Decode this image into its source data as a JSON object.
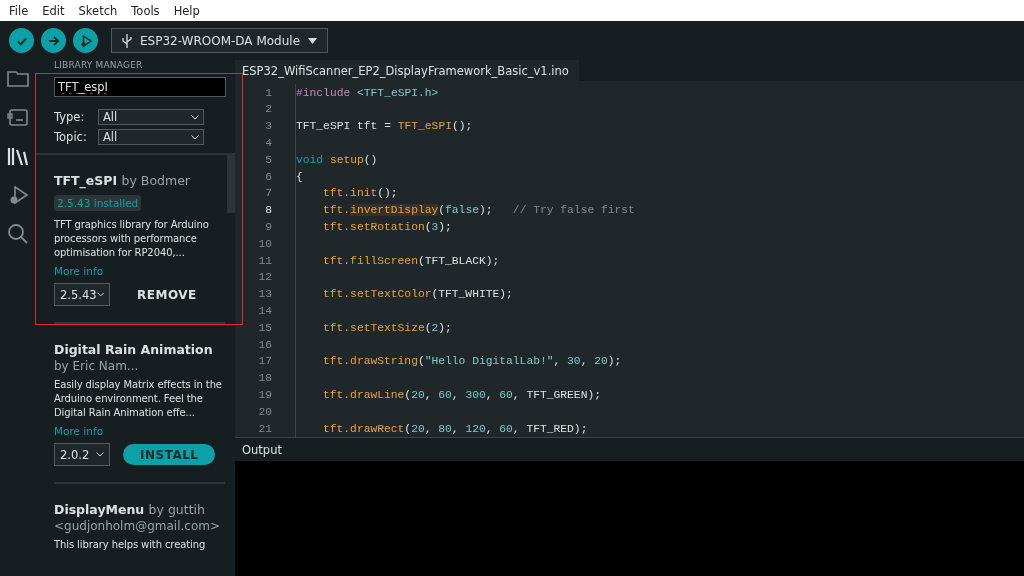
{
  "menu": [
    "File",
    "Edit",
    "Sketch",
    "Tools",
    "Help"
  ],
  "toolbar": {
    "buttons": [
      {
        "kind": "verify"
      },
      {
        "kind": "upload"
      },
      {
        "kind": "debug"
      }
    ],
    "board": "ESP32-WROOM-DA Module"
  },
  "activity_bar": [
    {
      "kind": "folder",
      "selected": false
    },
    {
      "kind": "board",
      "selected": false
    },
    {
      "kind": "library",
      "selected": true
    },
    {
      "kind": "debug",
      "selected": false
    },
    {
      "kind": "search",
      "selected": false
    }
  ],
  "library_manager": {
    "title": "LIBRARY MANAGER",
    "search_value": "TFT_espI",
    "filters": [
      {
        "label": "Type:",
        "value": "All"
      },
      {
        "label": "Topic:",
        "value": "All"
      }
    ],
    "libraries": [
      {
        "name": "TFT_eSPI",
        "author": "by Bodmer",
        "installed_badge": "2.5.43 installed",
        "description": "TFT graphics library for Arduino processors with performance optimisation for RP2040,...",
        "more_info": "More info",
        "version": "2.5.43",
        "action": {
          "kind": "remove",
          "label": "REMOVE"
        }
      },
      {
        "name": "Digital Rain Animation",
        "author": "by Eric Nam...",
        "description": "Easily display Matrix effects in the Arduino environment. Feel the Digital Rain Animation effe...",
        "more_info": "More info",
        "version": "2.0.2",
        "action": {
          "kind": "install",
          "label": "INSTALL"
        }
      },
      {
        "name": "DisplayMenu",
        "author": "by guttih",
        "email": "<gudjonholm@gmail.com>",
        "description": "This library helps with creating"
      }
    ]
  },
  "highlight_frame": true,
  "editor": {
    "tab": "ESP32_WifiScanner_EP2_DisplayFramework_Basic_v1.ino",
    "lines": [
      {
        "number": "1",
        "current": false,
        "indented": false,
        "segments": [
          {
            "kind": "preproc",
            "text": "#include"
          },
          {
            "kind": "string",
            "text": " <TFT_eSPI.h>"
          }
        ]
      },
      {
        "number": "2",
        "current": false
      },
      {
        "number": "3",
        "current": false,
        "indented": false,
        "segments": [
          {
            "kind": "plain",
            "text": "TFT_eSPI tft = "
          },
          {
            "kind": "func",
            "text": "TFT_eSPI"
          },
          {
            "kind": "plain",
            "text": "();"
          }
        ]
      },
      {
        "number": "4",
        "current": false
      },
      {
        "number": "5",
        "current": false,
        "indented": false,
        "segments": [
          {
            "kind": "keyword",
            "text": "void"
          },
          {
            "kind": "func",
            "text": " setup"
          },
          {
            "kind": "plain",
            "text": "()"
          }
        ]
      },
      {
        "number": "6",
        "current": false,
        "indented": false,
        "segments": [
          {
            "kind": "plain",
            "text": "{"
          }
        ]
      },
      {
        "number": "7",
        "current": false,
        "indented": true,
        "segments": [
          {
            "kind": "func",
            "text": "tft.init"
          },
          {
            "kind": "plain",
            "text": "();"
          }
        ]
      },
      {
        "number": "8",
        "current": true,
        "indented": true,
        "segments": [
          {
            "kind": "func",
            "text": "tft."
          },
          {
            "kind": "func-mark",
            "text": "invertDisplay"
          },
          {
            "kind": "plain",
            "text": "("
          },
          {
            "kind": "number",
            "text": "false"
          },
          {
            "kind": "plain",
            "text": ");   "
          },
          {
            "kind": "comment",
            "text": "// Try false first"
          }
        ]
      },
      {
        "number": "9",
        "current": false,
        "indented": true,
        "segments": [
          {
            "kind": "func",
            "text": "tft.setRotation"
          },
          {
            "kind": "plain",
            "text": "("
          },
          {
            "kind": "number",
            "text": "3"
          },
          {
            "kind": "plain",
            "text": ");"
          }
        ]
      },
      {
        "number": "10",
        "current": false
      },
      {
        "number": "11",
        "current": false,
        "indented": true,
        "segments": [
          {
            "kind": "func",
            "text": "tft.fillScreen"
          },
          {
            "kind": "plain",
            "text": "(TFT_BLACK);"
          }
        ]
      },
      {
        "number": "12",
        "current": false
      },
      {
        "number": "13",
        "current": false,
        "indented": true,
        "segments": [
          {
            "kind": "func",
            "text": "tft.setTextColor"
          },
          {
            "kind": "plain",
            "text": "(TFT_WHITE);"
          }
        ]
      },
      {
        "number": "14",
        "current": false
      },
      {
        "number": "15",
        "current": false,
        "indented": true,
        "segments": [
          {
            "kind": "func",
            "text": "tft.setTextSize"
          },
          {
            "kind": "plain",
            "text": "("
          },
          {
            "kind": "number",
            "text": "2"
          },
          {
            "kind": "plain",
            "text": ");"
          }
        ]
      },
      {
        "number": "16",
        "current": false
      },
      {
        "number": "17",
        "current": false,
        "indented": true,
        "segments": [
          {
            "kind": "func",
            "text": "tft.drawString"
          },
          {
            "kind": "plain",
            "text": "("
          },
          {
            "kind": "string",
            "text": "\"Hello DigitalLab!\""
          },
          {
            "kind": "plain",
            "text": ", "
          },
          {
            "kind": "number",
            "text": "30"
          },
          {
            "kind": "plain",
            "text": ", "
          },
          {
            "kind": "number",
            "text": "20"
          },
          {
            "kind": "plain",
            "text": ");"
          }
        ]
      },
      {
        "number": "18",
        "current": false
      },
      {
        "number": "19",
        "current": false,
        "indented": true,
        "segments": [
          {
            "kind": "func",
            "text": "tft.drawLine"
          },
          {
            "kind": "plain",
            "text": "("
          },
          {
            "kind": "number",
            "text": "20"
          },
          {
            "kind": "plain",
            "text": ", "
          },
          {
            "kind": "number",
            "text": "60"
          },
          {
            "kind": "plain",
            "text": ", "
          },
          {
            "kind": "number",
            "text": "300"
          },
          {
            "kind": "plain",
            "text": ", "
          },
          {
            "kind": "number",
            "text": "60"
          },
          {
            "kind": "plain",
            "text": ", TFT_GREEN);"
          }
        ]
      },
      {
        "number": "20",
        "current": false
      },
      {
        "number": "21",
        "current": false,
        "indented": true,
        "segments": [
          {
            "kind": "func",
            "text": "tft.drawRect"
          },
          {
            "kind": "plain",
            "text": "("
          },
          {
            "kind": "number",
            "text": "20"
          },
          {
            "kind": "plain",
            "text": ", "
          },
          {
            "kind": "number",
            "text": "80"
          },
          {
            "kind": "plain",
            "text": ", "
          },
          {
            "kind": "number",
            "text": "120"
          },
          {
            "kind": "plain",
            "text": ", "
          },
          {
            "kind": "number",
            "text": "60"
          },
          {
            "kind": "plain",
            "text": ", TFT_RED);"
          }
        ]
      }
    ]
  },
  "output": {
    "title": "Output"
  }
}
